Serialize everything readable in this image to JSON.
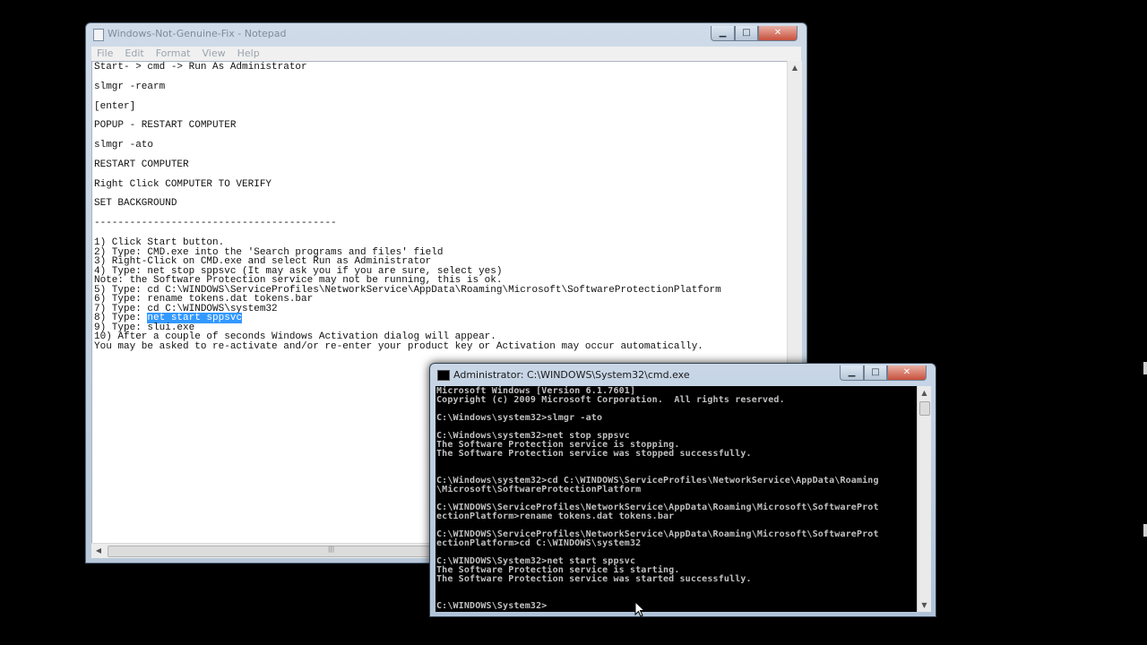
{
  "notepad": {
    "title": "Windows-Not-Genuine-Fix - Notepad",
    "menu": [
      "File",
      "Edit",
      "Format",
      "View",
      "Help"
    ],
    "lines_top": [
      "Start- > cmd -> Run As Administrator",
      "",
      "slmgr -rearm",
      "",
      "[enter]",
      "",
      "POPUP - RESTART COMPUTER",
      "",
      "slmgr -ato",
      "",
      "RESTART COMPUTER",
      "",
      "Right Click COMPUTER TO VERIFY",
      "",
      "SET BACKGROUND",
      "",
      "-----------------------------------------",
      ""
    ],
    "step_lines": [
      "1) Click Start button.",
      "2) Type: CMD.exe into the 'Search programs and files' field",
      "3) Right-Click on CMD.exe and select Run as Administrator",
      "4) Type: net stop sppsvc (It may ask you if you are sure, select yes)",
      "Note: the Software Protection service may not be running, this is ok.",
      "5) Type: cd C:\\WINDOWS\\ServiceProfiles\\NetworkService\\AppData\\Roaming\\Microsoft\\SoftwareProtectionPlatform",
      "6) Type: rename tokens.dat tokens.bar",
      "7) Type: cd C:\\WINDOWS\\system32"
    ],
    "step8_prefix": "8) Type: ",
    "step8_selected": "net start sppsvc",
    "step_lines_after": [
      "9) Type: slui.exe",
      "10) After a couple of seconds Windows Activation dialog will appear.",
      "You may be asked to re-activate and/or re-enter your product key or Activation may occur automatically."
    ]
  },
  "cmd": {
    "title": "Administrator: C:\\WINDOWS\\System32\\cmd.exe",
    "lines": [
      "Microsoft Windows [Version 6.1.7601]",
      "Copyright (c) 2009 Microsoft Corporation.  All rights reserved.",
      "",
      "C:\\Windows\\system32>slmgr -ato",
      "",
      "C:\\Windows\\system32>net stop sppsvc",
      "The Software Protection service is stopping.",
      "The Software Protection service was stopped successfully.",
      "",
      "",
      "C:\\Windows\\system32>cd C:\\WINDOWS\\ServiceProfiles\\NetworkService\\AppData\\Roaming",
      "\\Microsoft\\SoftwareProtectionPlatform",
      "",
      "C:\\WINDOWS\\ServiceProfiles\\NetworkService\\AppData\\Roaming\\Microsoft\\SoftwareProt",
      "ectionPlatform>rename tokens.dat tokens.bar",
      "",
      "C:\\WINDOWS\\ServiceProfiles\\NetworkService\\AppData\\Roaming\\Microsoft\\SoftwareProt",
      "ectionPlatform>cd C:\\WINDOWS\\system32",
      "",
      "C:\\WINDOWS\\System32>net start sppsvc",
      "The Software Protection service is starting.",
      "The Software Protection service was started successfully.",
      "",
      "",
      "C:\\WINDOWS\\System32>"
    ]
  },
  "icons": {
    "minimize": "minimize-icon",
    "maximize": "maximize-icon",
    "close": "close-icon",
    "pointer": "mouse-pointer-icon"
  }
}
